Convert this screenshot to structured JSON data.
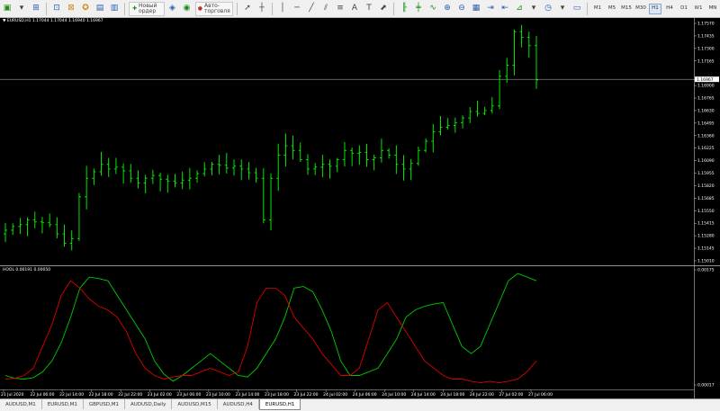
{
  "toolbar": {
    "new_order_label": "Новый ордер",
    "autotrade_label": "Авто-торговля",
    "timeframes": [
      "M1",
      "M5",
      "M15",
      "M30",
      "H1",
      "H4",
      "D1",
      "W1",
      "MN"
    ],
    "active_timeframe": "H1"
  },
  "chart": {
    "symbol_info": "▼ EURUSD,H1  1.17044 1.17044 1.16940 1.16967",
    "indicator_info": "HOOL 0.00191 0.00050",
    "price_axis": [
      "1.17570",
      "1.17435",
      "1.17300",
      "1.17165",
      "1.16967",
      "1.16900",
      "1.16765",
      "1.16630",
      "1.16495",
      "1.16360",
      "1.16225",
      "1.16090",
      "1.15955",
      "1.15820",
      "1.15685",
      "1.15550",
      "1.15415",
      "1.15280",
      "1.15145",
      "1.15010"
    ],
    "current_price": "1.16967",
    "indicator_axis": [
      "0.00175",
      "0.00017"
    ],
    "time_axis": [
      "21 Jul 2020",
      "22 Jul 06:00",
      "22 Jul 14:00",
      "22 Jul 18:00",
      "22 Jul 22:00",
      "23 Jul 02:00",
      "23 Jul 06:00",
      "23 Jul 10:00",
      "23 Jul 14:00",
      "23 Jul 18:00",
      "23 Jul 22:00",
      "24 Jul 02:00",
      "24 Jul 06:00",
      "24 Jul 10:00",
      "24 Jul 14:00",
      "24 Jul 18:00",
      "24 Jul 22:00",
      "27 Jul 02:00",
      "27 Jul 06:00"
    ],
    "colors": {
      "bars": "#00ff00",
      "green_line": "#00cc00",
      "red_line": "#dd0000",
      "grid": "#c0c0c0",
      "background": "#000000"
    }
  },
  "tabs": [
    "AUDUSD,M1",
    "EURUSD,M1",
    "GBPUSD,M1",
    "AUDUSD,Daily",
    "AUDUSD,M15",
    "AUDUSD,H4",
    "EURUSD,H1"
  ],
  "active_tab": "EURUSD,H1",
  "chart_data": {
    "type": "line",
    "title": "",
    "candles_close": [
      1.1534,
      1.1538,
      1.154,
      1.1545,
      1.1543,
      1.1542,
      1.154,
      1.153,
      1.152,
      1.1525,
      1.157,
      1.159,
      1.1597,
      1.1605,
      1.16,
      1.1602,
      1.1598,
      1.159,
      1.1585,
      1.159,
      1.1593,
      1.1589,
      1.1587,
      1.1585,
      1.1588,
      1.159,
      1.1595,
      1.16,
      1.1605,
      1.1604,
      1.1601,
      1.1603,
      1.16,
      1.1596,
      1.159,
      1.1545,
      1.159,
      1.1615,
      1.1625,
      1.162,
      1.161,
      1.16,
      1.1602,
      1.1605,
      1.1603,
      1.161,
      1.162,
      1.1617,
      1.1618,
      1.161,
      1.1612,
      1.162,
      1.1615,
      1.1605,
      1.16,
      1.1606,
      1.162,
      1.163,
      1.164,
      1.1645,
      1.1647,
      1.165,
      1.1655,
      1.1662,
      1.166,
      1.1663,
      1.1668,
      1.17,
      1.1712,
      1.1748,
      1.1742,
      1.1733,
      1.1696
    ],
    "indicator_series": [
      {
        "values": [
          0.0003,
          0.00026,
          0.00025,
          0.00027,
          0.00035,
          0.0005,
          0.00075,
          0.0011,
          0.0015,
          0.00165,
          0.00163,
          0.0016,
          0.0014,
          0.0012,
          0.001,
          0.0008,
          0.0005,
          0.00032,
          0.00022,
          0.0003,
          0.0004,
          0.0005,
          0.0006,
          0.0005,
          0.0004,
          0.0003,
          0.00028,
          0.0004,
          0.0006,
          0.0008,
          0.0011,
          0.0015,
          0.00152,
          0.00145,
          0.0012,
          0.0009,
          0.0005,
          0.0003,
          0.0003,
          0.00035,
          0.0004,
          0.0006,
          0.0008,
          0.0011,
          0.0012,
          0.00125,
          0.00128,
          0.0013,
          0.001,
          0.0007,
          0.0006,
          0.0007,
          0.001,
          0.0013,
          0.0016,
          0.0017,
          0.00165,
          0.0016
        ]
      },
      {
        "values": [
          0.00025,
          0.00026,
          0.0003,
          0.0004,
          0.0007,
          0.001,
          0.0014,
          0.0016,
          0.0015,
          0.00135,
          0.00125,
          0.0012,
          0.0011,
          0.0009,
          0.0006,
          0.0004,
          0.0003,
          0.00025,
          0.00028,
          0.0003,
          0.0003,
          0.00035,
          0.0004,
          0.00035,
          0.0003,
          0.00035,
          0.0007,
          0.0013,
          0.0015,
          0.0015,
          0.0014,
          0.0011,
          0.00095,
          0.0008,
          0.0006,
          0.00045,
          0.0003,
          0.0003,
          0.0004,
          0.0008,
          0.0012,
          0.0013,
          0.0011,
          0.0009,
          0.0007,
          0.0005,
          0.0004,
          0.0003,
          0.00025,
          0.00025,
          0.00022,
          0.0002,
          0.00022,
          0.0002,
          0.00022,
          0.00025,
          0.00035,
          0.0005
        ]
      }
    ],
    "ylim_price": [
      1.1501,
      1.1757
    ],
    "ylim_indicator": [
      0.00017,
      0.00175
    ]
  }
}
